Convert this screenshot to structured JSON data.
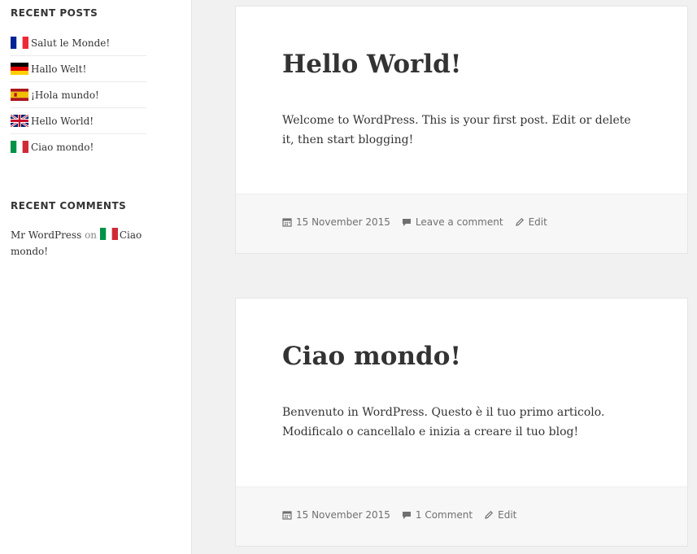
{
  "sidebar": {
    "recent_posts_title": "RECENT POSTS",
    "recent_posts": [
      {
        "label": "Salut le Monde!",
        "flag": "flag-fr-icon"
      },
      {
        "label": "Hallo Welt!",
        "flag": "flag-de-icon"
      },
      {
        "label": "¡Hola mundo!",
        "flag": "flag-es-icon"
      },
      {
        "label": "Hello World!",
        "flag": "flag-gb-icon"
      },
      {
        "label": "Ciao mondo!",
        "flag": "flag-it-icon"
      }
    ],
    "recent_comments_title": "RECENT COMMENTS",
    "recent_comment": {
      "author": "Mr WordPress",
      "on": "on",
      "post": "Ciao mondo!"
    }
  },
  "posts": [
    {
      "title": "Hello World!",
      "content": "Welcome to WordPress. This is your first post. Edit or delete it, then start blogging!",
      "date": "15 November 2015",
      "comments": "Leave a comment",
      "edit": "Edit"
    },
    {
      "title": "Ciao mondo!",
      "content": "Benvenuto in WordPress. Questo è il tuo primo articolo. Modificalo o cancellalo e inizia a creare il tuo blog!",
      "date": "15 November 2015",
      "comments": "1 Comment",
      "edit": "Edit"
    }
  ],
  "colors": {
    "text": "#333333",
    "meta": "#707070",
    "footer_bg": "#f7f7f7",
    "page_bg": "#f1f1f1"
  }
}
